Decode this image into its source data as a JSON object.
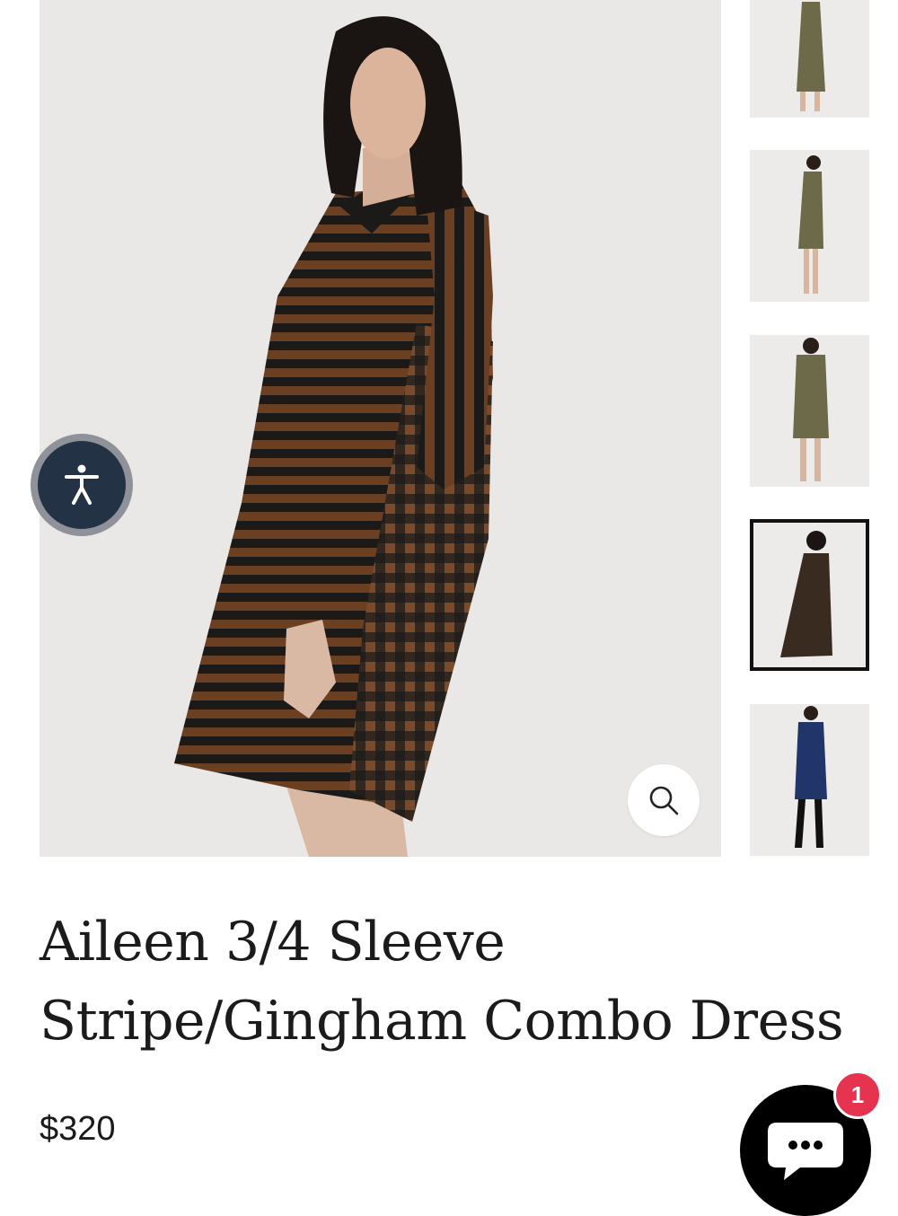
{
  "product": {
    "title": "Aileen 3/4 Sleeve Stripe/Gingham Combo Dress",
    "price": "$320"
  },
  "gallery": {
    "thumbnails": [
      {
        "colorway": "olive-gingham",
        "view": "front",
        "selected": false
      },
      {
        "colorway": "olive-gingham",
        "view": "side",
        "selected": false
      },
      {
        "colorway": "olive-gingham",
        "view": "back",
        "selected": false
      },
      {
        "colorway": "brown-black-stripe",
        "view": "side",
        "selected": true
      },
      {
        "colorway": "navy",
        "view": "front",
        "selected": false
      }
    ]
  },
  "icons": {
    "zoom": "magnifier-icon",
    "accessibility": "accessibility-person-icon",
    "chat": "chat-bubble-icon"
  },
  "chat": {
    "badge_count": "1"
  },
  "colors": {
    "accessibility_button": "#243246",
    "chat_badge": "#e6334f",
    "selected_thumb_border": "#111111"
  }
}
